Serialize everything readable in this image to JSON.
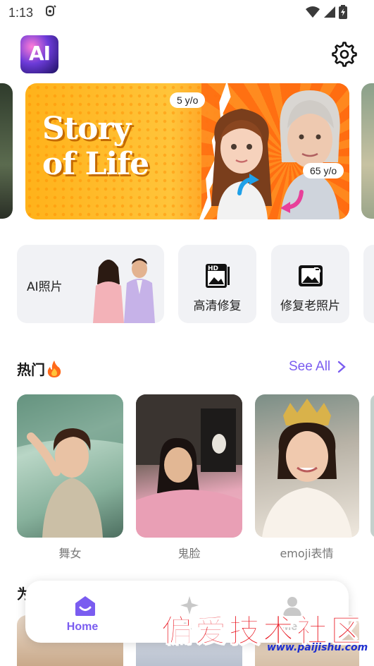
{
  "status_bar": {
    "time": "1:13"
  },
  "banner": {
    "title_line1": "Story",
    "title_line2": "of Life",
    "age_young": "5 y/o",
    "age_old": "65 y/o"
  },
  "app": {
    "logo_text": "AI"
  },
  "tiles": [
    {
      "label": "AI照片"
    },
    {
      "label": "高清修复"
    },
    {
      "label": "修复老照片"
    }
  ],
  "hot": {
    "title": "热门",
    "see_all": "See All",
    "cards": [
      {
        "caption": "舞女"
      },
      {
        "caption": "鬼脸"
      },
      {
        "caption": "emoji表情"
      }
    ]
  },
  "section2": {
    "title_partial": "为"
  },
  "nav": {
    "home": "Home",
    "ai": "AI",
    "me": "Me"
  },
  "watermark": {
    "text": "偏爱技术社区",
    "url": "www.paijishu.com"
  },
  "colors": {
    "accent": "#7a5cf0",
    "banner_orange": "#ff9a1f",
    "tile_bg": "#f1f2f5"
  }
}
